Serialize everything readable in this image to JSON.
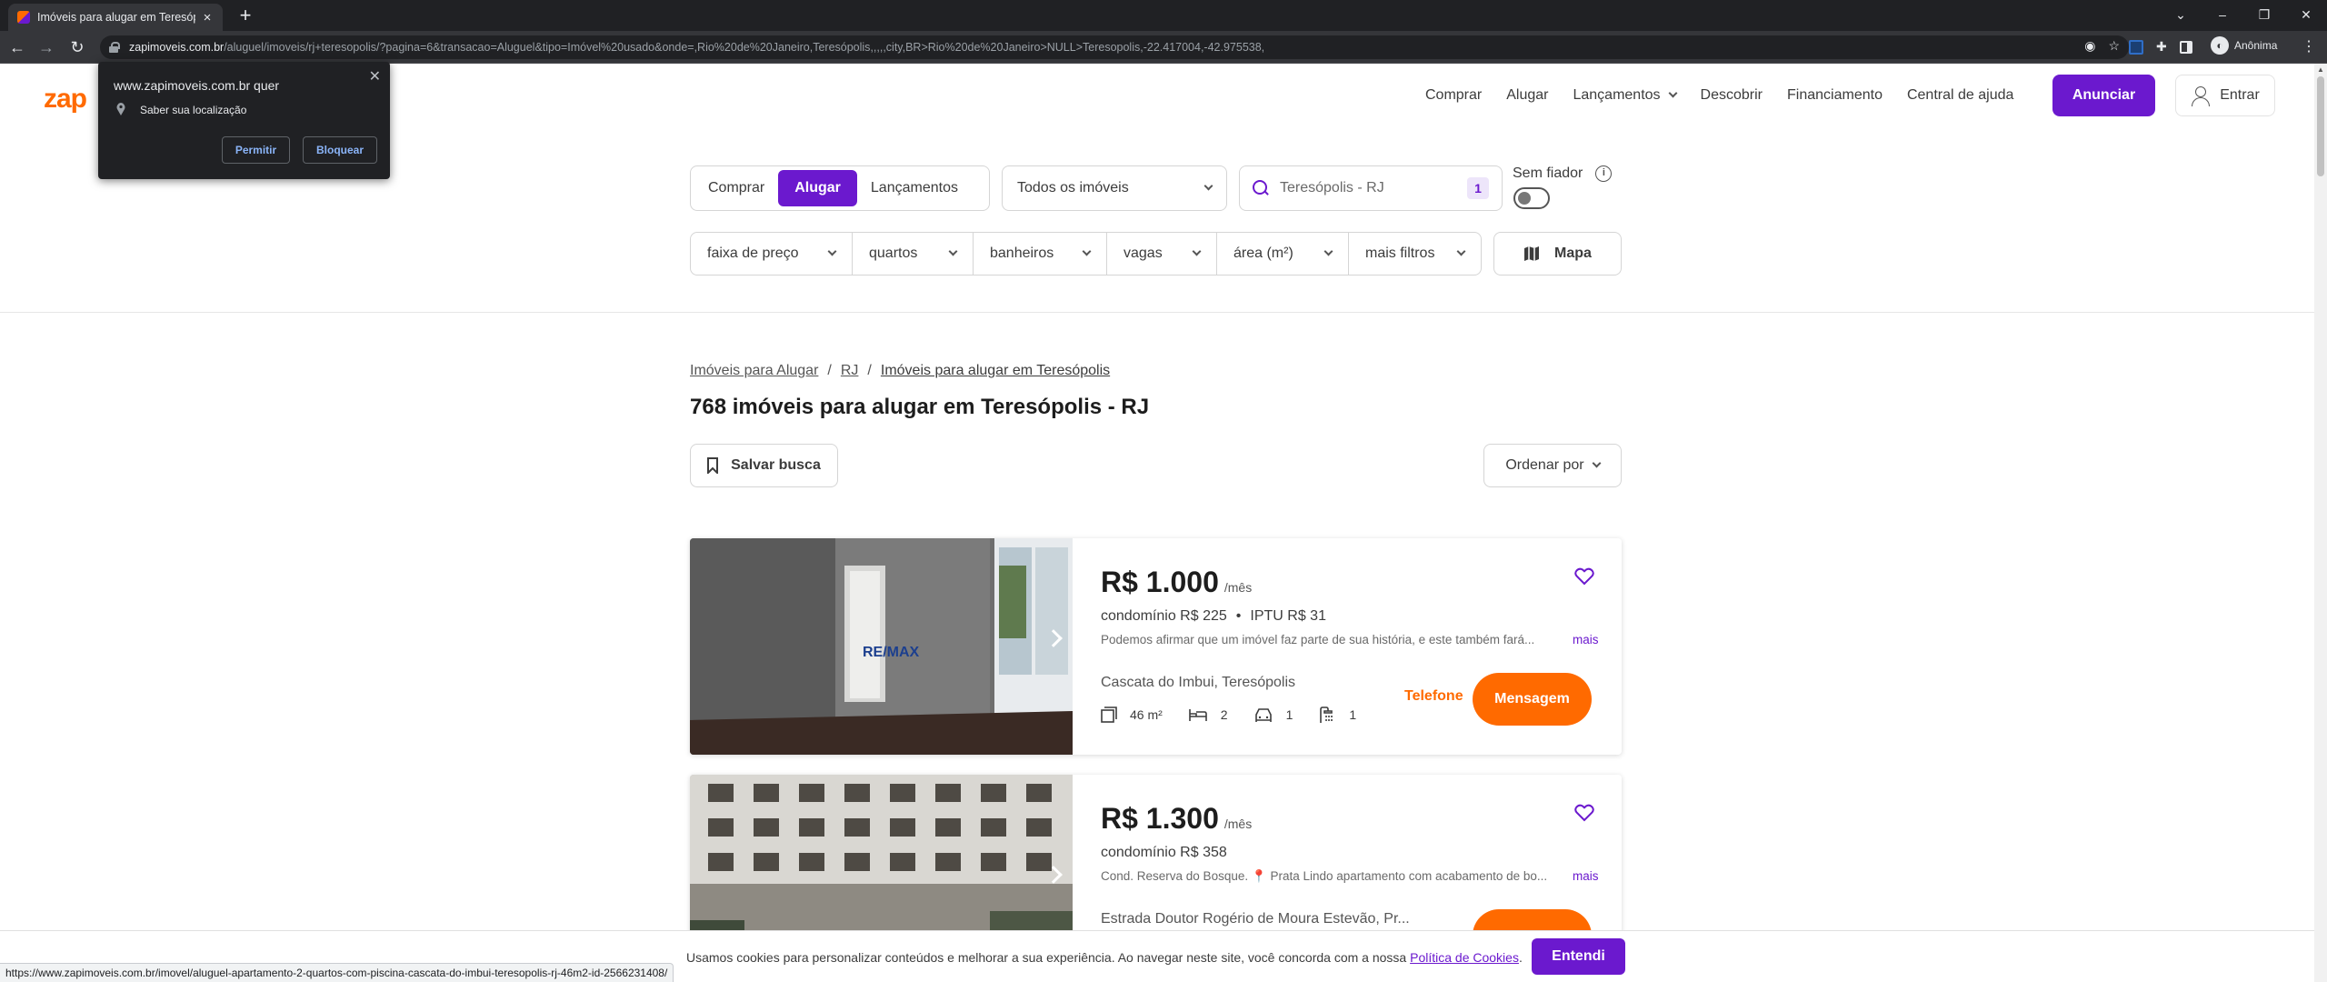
{
  "browser": {
    "tab_title": "Imóveis para alugar em Teresópolis",
    "url_host": "zapimoveis.com.br",
    "url_path": "/aluguel/imoveis/rj+teresopolis/?pagina=6&transacao=Aluguel&tipo=Imóvel%20usado&onde=,Rio%20de%20Janeiro,Teresópolis,,,,,city,BR>Rio%20de%20Janeiro>NULL>Teresopolis,-22.417004,-42.975538,",
    "profile_label": "Anônima",
    "status_url": "https://www.zapimoveis.com.br/imovel/aluguel-apartamento-2-quartos-com-piscina-cascata-do-imbui-teresopolis-rj-46m2-id-2566231408/"
  },
  "permission": {
    "site": "www.zapimoveis.com.br quer",
    "request": "Saber sua localização",
    "allow": "Permitir",
    "block": "Bloquear"
  },
  "header": {
    "logo": "zap",
    "nav": [
      "Comprar",
      "Alugar",
      "Lançamentos",
      "Descobrir",
      "Financiamento",
      "Central de ajuda"
    ],
    "anunciar": "Anunciar",
    "entrar": "Entrar"
  },
  "search": {
    "tabs": [
      "Comprar",
      "Alugar",
      "Lançamentos"
    ],
    "active_tab": "Alugar",
    "type": "Todos os imóveis",
    "location": "Teresópolis - RJ",
    "location_count": "1",
    "sem_fiador": "Sem fiador",
    "sem_fiador_on": false,
    "filters": [
      "faixa de preço",
      "quartos",
      "banheiros",
      "vagas",
      "área (m²)",
      "mais filtros"
    ],
    "mapa": "Mapa"
  },
  "results": {
    "breadcrumb": [
      "Imóveis para Alugar",
      "RJ",
      "Imóveis para alugar em Teresópolis"
    ],
    "title": "768 imóveis para alugar em Teresópolis - RJ",
    "save": "Salvar busca",
    "sort": "Ordenar por"
  },
  "listings": [
    {
      "price": "R$ 1.000",
      "price_suffix": "/mês",
      "condominio": "condomínio R$ 225",
      "iptu": "IPTU R$ 31",
      "description": "Podemos afirmar que um imóvel faz parte de sua história, e este também fará...",
      "more": "mais",
      "address": "Cascata do Imbui, Teresópolis",
      "area": "46 m²",
      "bedrooms": "2",
      "parking": "1",
      "bathrooms": "1",
      "phone": "Telefone",
      "message": "Mensagem",
      "photo_watermark": "RE/MAX"
    },
    {
      "price": "R$ 1.300",
      "price_suffix": "/mês",
      "condominio": "condomínio R$ 358",
      "description_prefix": "Cond. Reserva do Bosque.",
      "description": "Prata Lindo apartamento com acabamento de bo...",
      "more": "mais",
      "address": "Estrada Doutor Rogério de Moura Estevão, Pr..."
    }
  ],
  "cookie": {
    "text": "Usamos cookies para personalizar conteúdos e melhorar a sua experiência. Ao navegar neste site, você concorda com a nossa ",
    "link": "Política de Cookies",
    "end": ".",
    "button": "Entendi"
  },
  "colors": {
    "brand_purple": "#6b19ce",
    "brand_orange": "#ff6a00"
  }
}
